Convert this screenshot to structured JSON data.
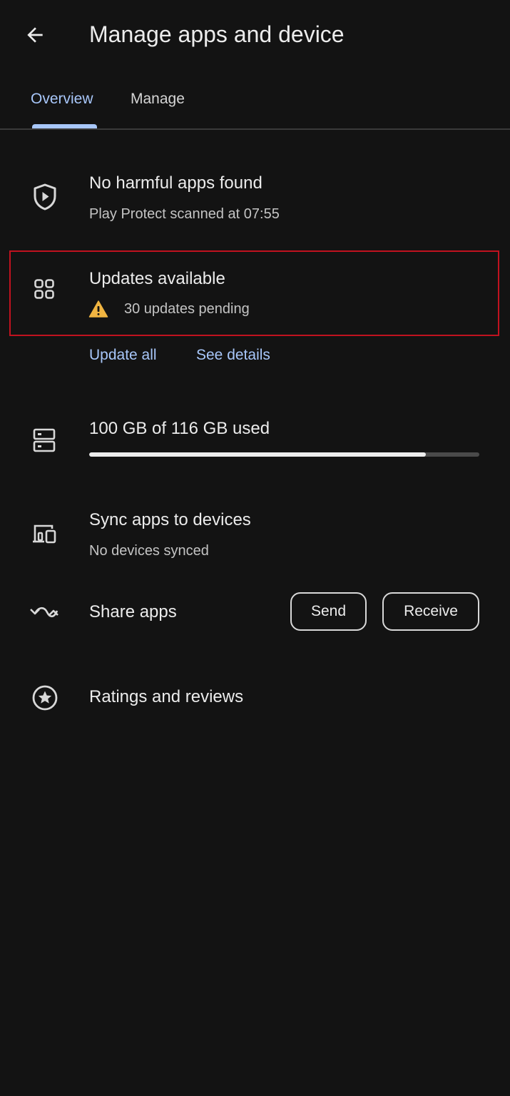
{
  "header": {
    "back_icon": "arrow-back-icon",
    "title": "Manage apps and device"
  },
  "tabs": [
    {
      "label": "Overview",
      "selected": true
    },
    {
      "label": "Manage",
      "selected": false
    }
  ],
  "colors": {
    "accent": "#a8c7fa",
    "background": "#131313",
    "highlight_border": "#c1121f",
    "warning": "#f0b441"
  },
  "play_protect": {
    "icon": "shield-play-icon",
    "title": "No harmful apps found",
    "subtitle": "Play Protect scanned at 07:55"
  },
  "updates": {
    "icon": "apps-grid-icon",
    "title": "Updates available",
    "status_icon": "warning-icon",
    "status": "30 updates pending",
    "update_all_label": "Update all",
    "see_details_label": "See details"
  },
  "storage": {
    "icon": "storage-icon",
    "label": "100 GB of 116 GB used",
    "used_gb": 100,
    "total_gb": 116
  },
  "sync": {
    "icon": "devices-icon",
    "title": "Sync apps to devices",
    "subtitle": "No devices synced"
  },
  "share": {
    "icon": "share-apps-icon",
    "title": "Share apps",
    "send_label": "Send",
    "receive_label": "Receive"
  },
  "ratings": {
    "icon": "star-circle-icon",
    "title": "Ratings and reviews"
  }
}
